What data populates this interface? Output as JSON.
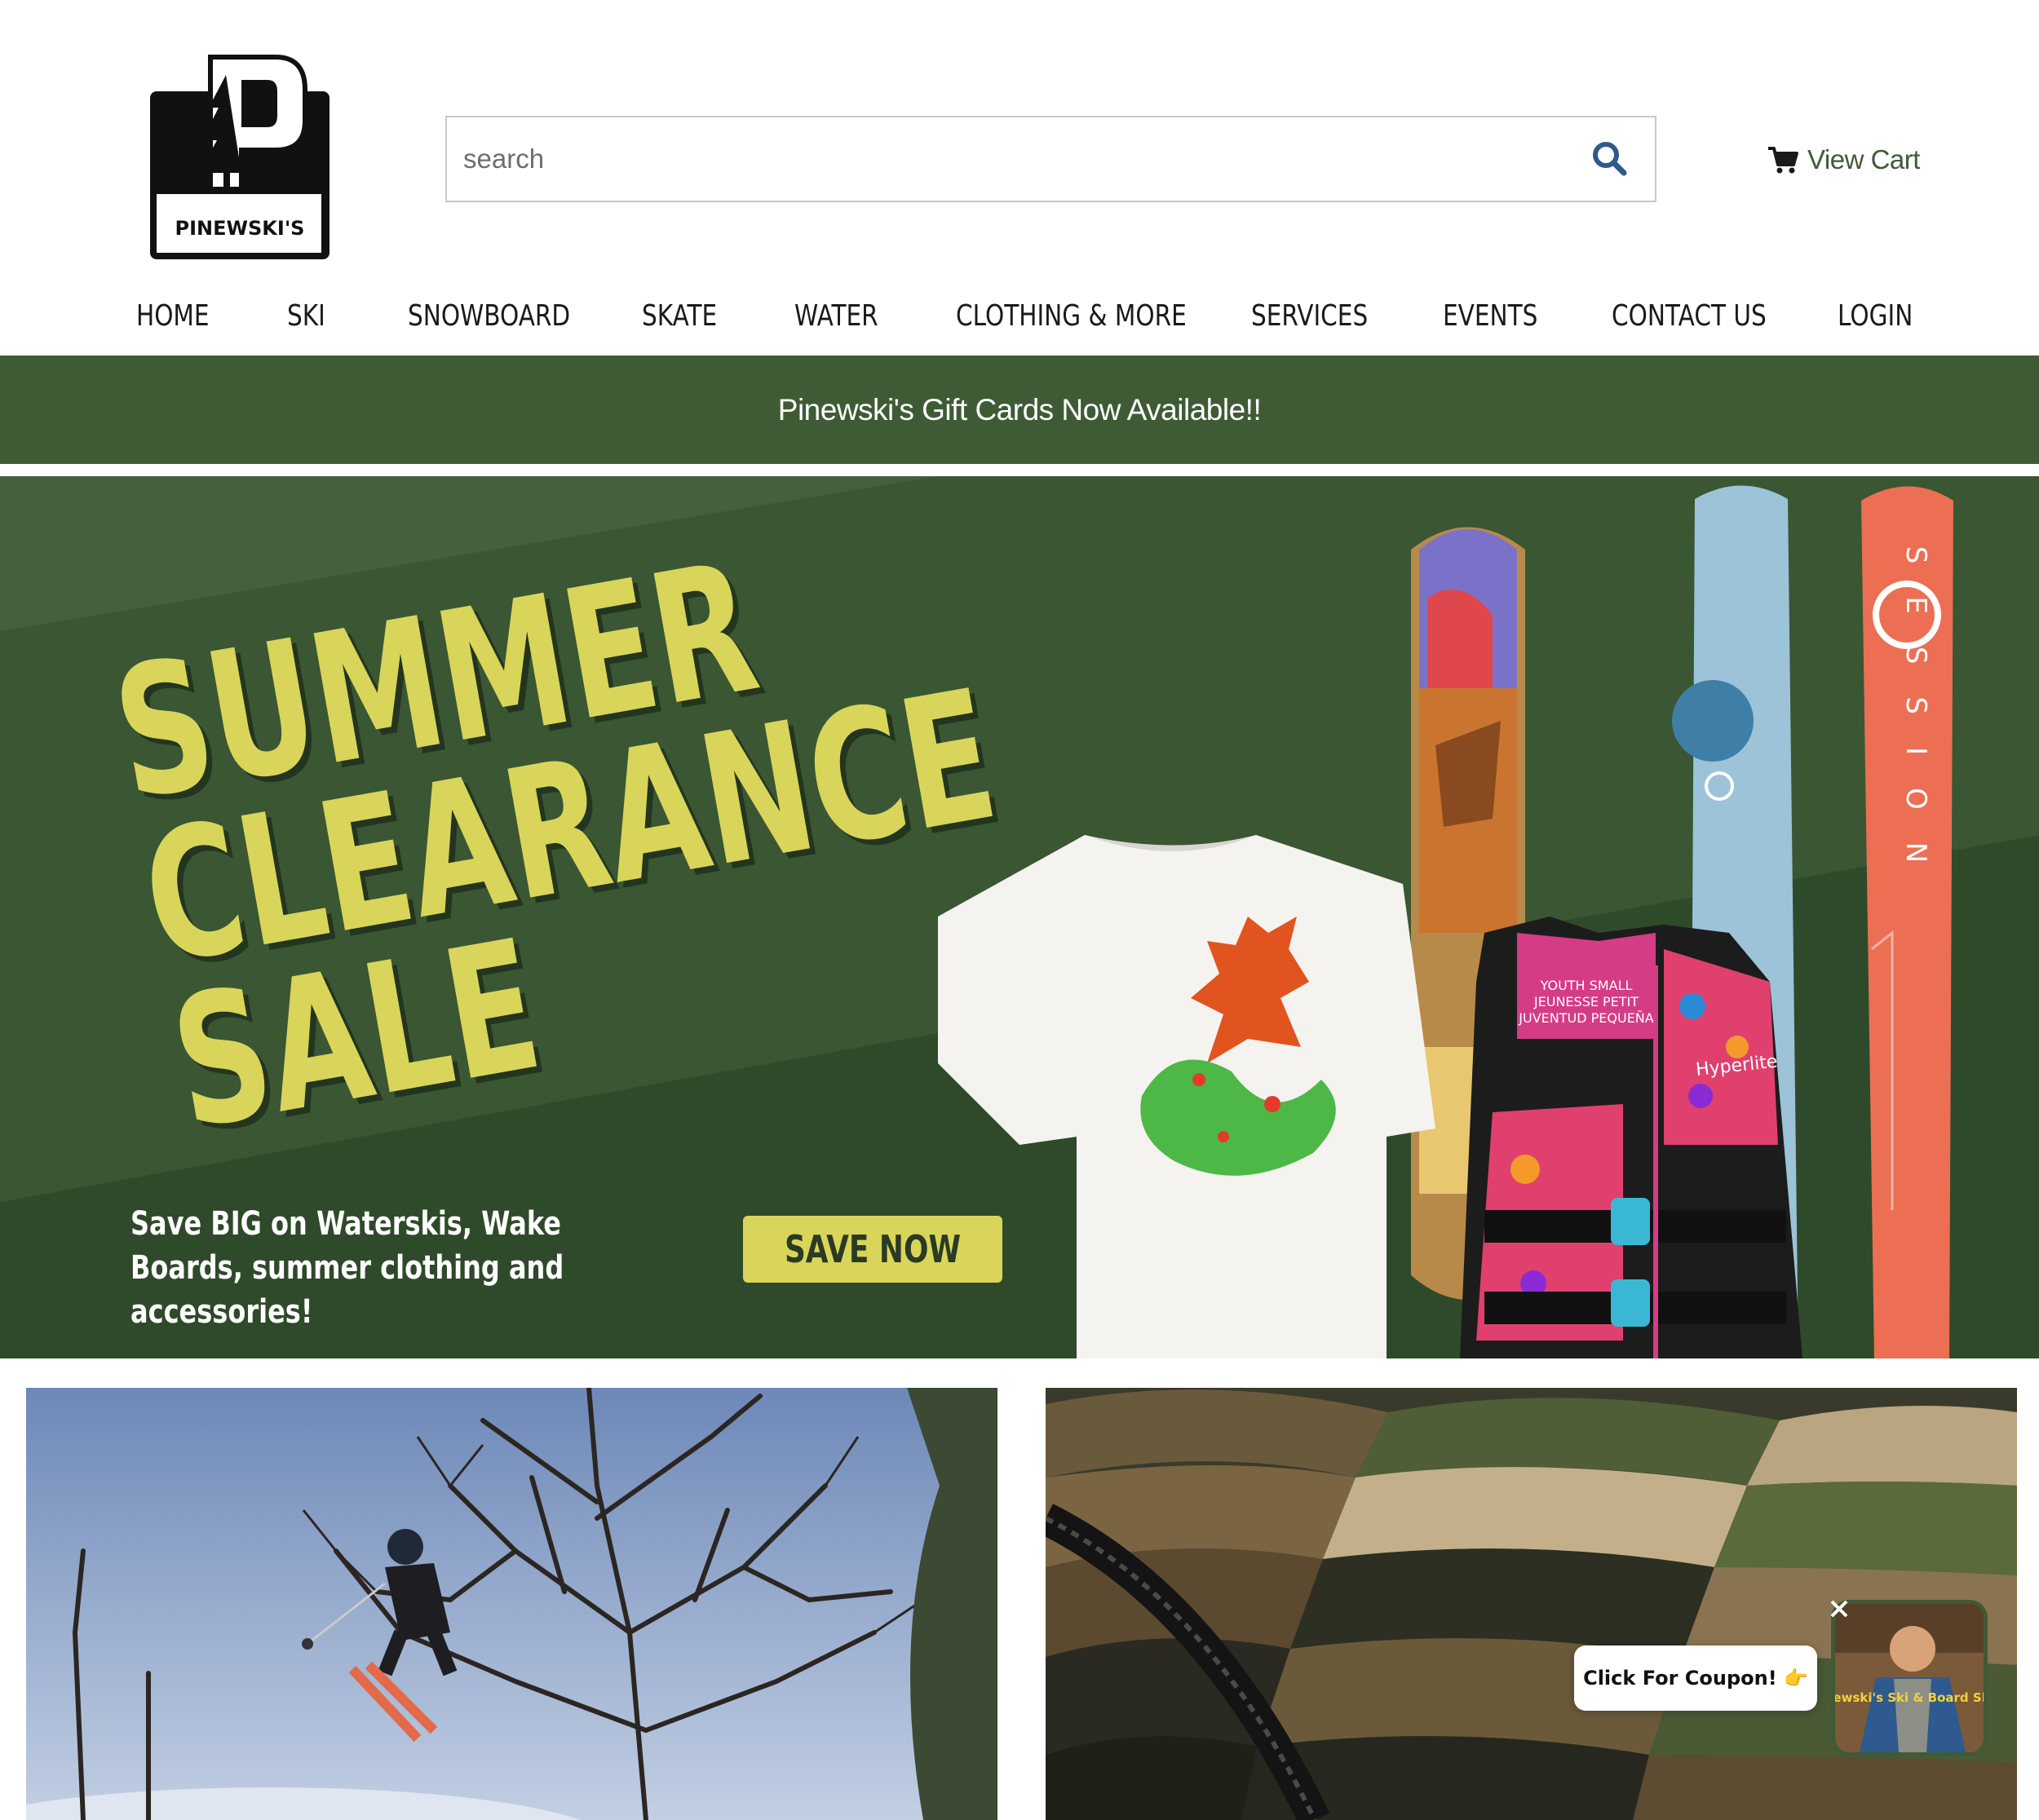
{
  "brand": {
    "logo_text": "PINEWSKI'S"
  },
  "search": {
    "placeholder": "search"
  },
  "cart": {
    "label": "View Cart"
  },
  "nav": {
    "items": [
      {
        "label": "HOME"
      },
      {
        "label": "SKI"
      },
      {
        "label": "SNOWBOARD"
      },
      {
        "label": "SKATE"
      },
      {
        "label": "WATER"
      },
      {
        "label": "CLOTHING & MORE"
      },
      {
        "label": "SERVICES"
      },
      {
        "label": "EVENTS"
      },
      {
        "label": "CONTACT US"
      },
      {
        "label": "LOGIN"
      }
    ]
  },
  "announcement": {
    "text": "Pinewski's Gift Cards Now Available!!"
  },
  "hero": {
    "headline_lines": [
      "SUMMER",
      "CLEARANCE",
      "SALE"
    ],
    "subtext": "Save BIG on Waterskis, Wake Boards, summer clothing and accessories!",
    "cta_label": "SAVE NOW",
    "product_text": {
      "vest_label": "YOUTH SMALL\nJEUNESSE PETIT\nJUVENTUD PEQUEÑA",
      "vest_brand": "Hyperlite",
      "ski_brand": "SESSION"
    }
  },
  "coupon": {
    "label": "Click For Coupon! 👉",
    "thumb_text": "Pinewski's Ski & Board Shop"
  },
  "colors": {
    "brand_green": "#3e5b36",
    "hero_green": "#3a5633",
    "headline_yellow": "#d8d55a",
    "cart_green": "#3f5a38"
  }
}
